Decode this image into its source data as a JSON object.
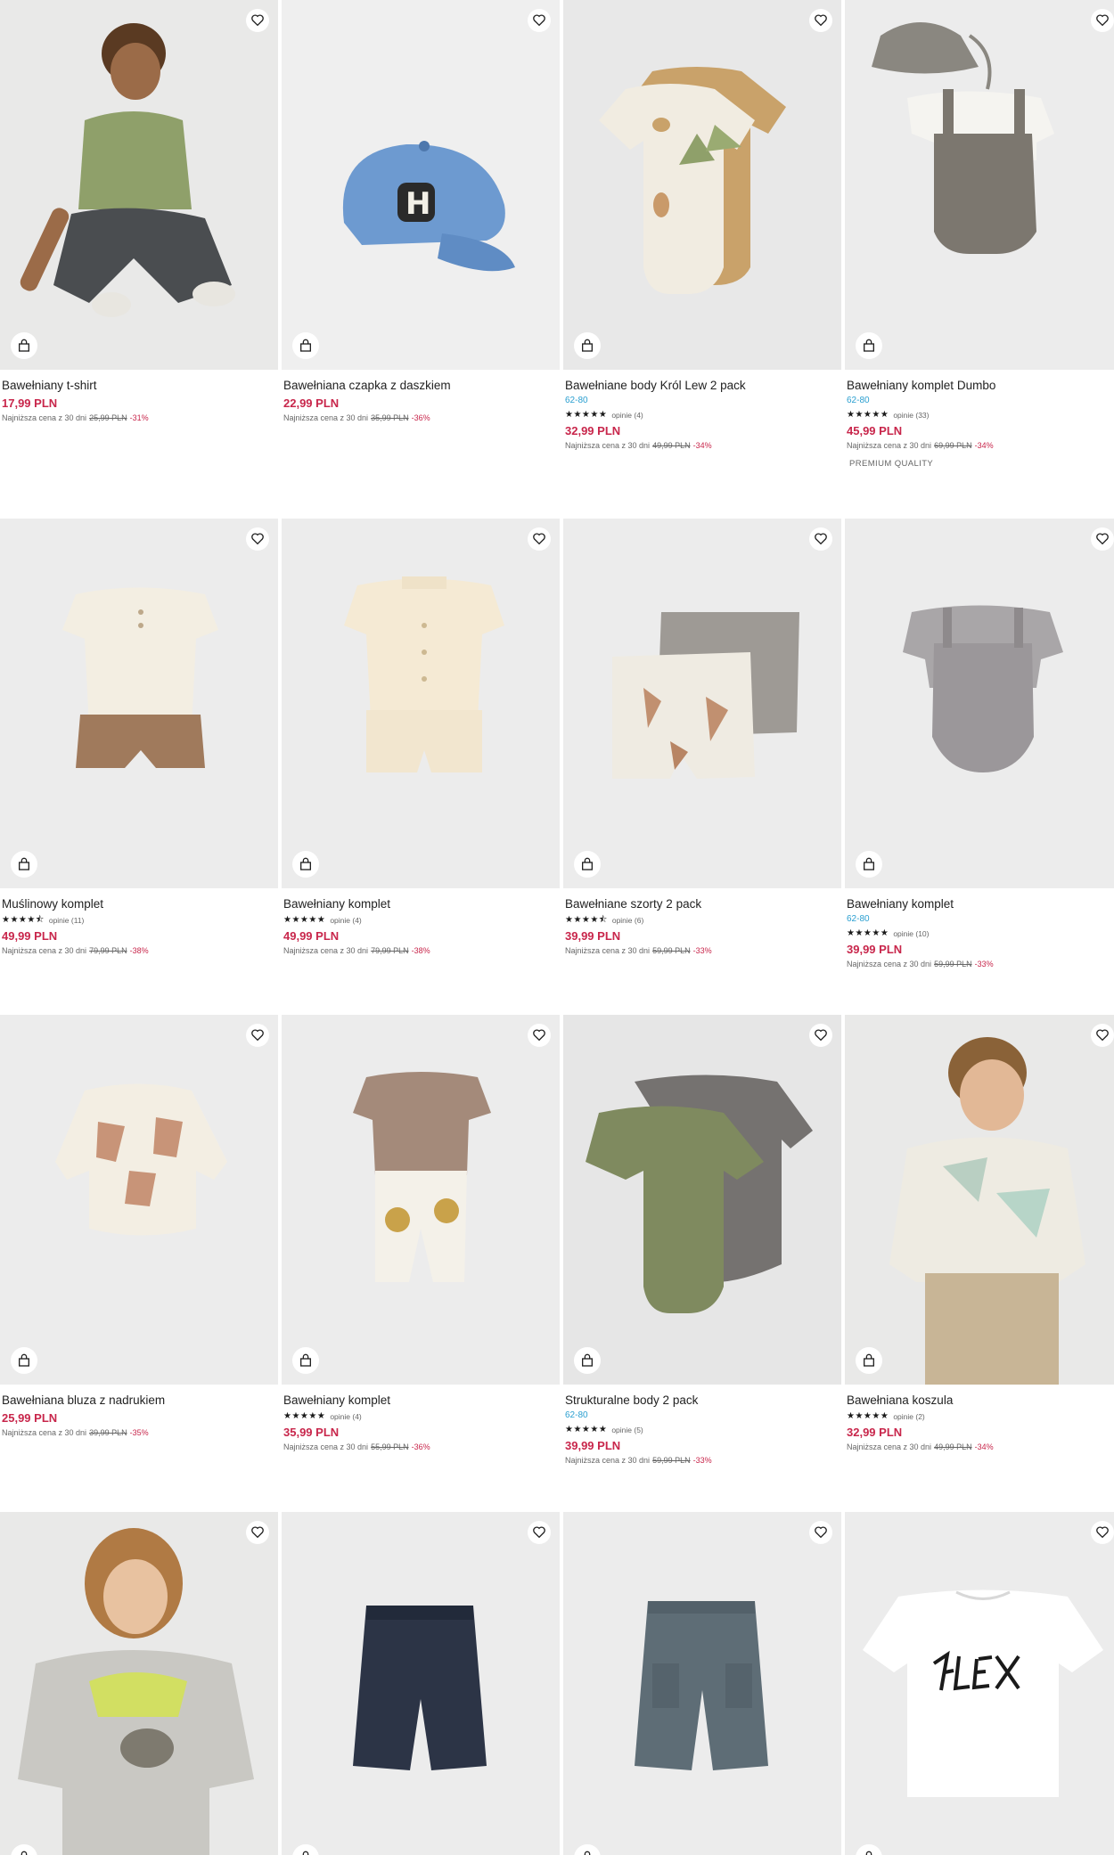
{
  "lowest_label": "Najniższa cena z 30 dni",
  "rows": [
    [
      {
        "name": "Bawełniany t-shirt",
        "sizes": "",
        "stars": "",
        "reviews": "",
        "price": "17,99 PLN",
        "old": "25,99 PLN",
        "disc": "-31%",
        "badge": ""
      },
      {
        "name": "Bawełniana czapka z daszkiem",
        "sizes": "",
        "stars": "",
        "reviews": "",
        "price": "22,99 PLN",
        "old": "35,99 PLN",
        "disc": "-36%",
        "badge": ""
      },
      {
        "name": "Bawełniane body Król Lew 2 pack",
        "sizes": "62-80",
        "stars": "★★★★★",
        "reviews": "opinie (4)",
        "price": "32,99 PLN",
        "old": "49,99 PLN",
        "disc": "-34%",
        "badge": ""
      },
      {
        "name": "Bawełniany komplet Dumbo",
        "sizes": "62-80",
        "stars": "★★★★★",
        "reviews": "opinie (33)",
        "price": "45,99 PLN",
        "old": "69,99 PLN",
        "disc": "-34%",
        "badge": "PREMIUM QUALITY"
      }
    ],
    [
      {
        "name": "Muślinowy komplet",
        "sizes": "",
        "stars": "★★★★⯪",
        "reviews": "opinie (11)",
        "price": "49,99 PLN",
        "old": "79,99 PLN",
        "disc": "-38%",
        "badge": ""
      },
      {
        "name": "Bawełniany komplet",
        "sizes": "",
        "stars": "★★★★★",
        "reviews": "opinie (4)",
        "price": "49,99 PLN",
        "old": "79,99 PLN",
        "disc": "-38%",
        "badge": ""
      },
      {
        "name": "Bawełniane szorty 2 pack",
        "sizes": "",
        "stars": "★★★★⯪",
        "reviews": "opinie (6)",
        "price": "39,99 PLN",
        "old": "59,99 PLN",
        "disc": "-33%",
        "badge": ""
      },
      {
        "name": "Bawełniany komplet",
        "sizes": "62-80",
        "stars": "★★★★★",
        "reviews": "opinie (10)",
        "price": "39,99 PLN",
        "old": "59,99 PLN",
        "disc": "-33%",
        "badge": ""
      }
    ],
    [
      {
        "name": "Bawełniana bluza z nadrukiem",
        "sizes": "",
        "stars": "",
        "reviews": "",
        "price": "25,99 PLN",
        "old": "39,99 PLN",
        "disc": "-35%",
        "badge": ""
      },
      {
        "name": "Bawełniany komplet",
        "sizes": "",
        "stars": "★★★★★",
        "reviews": "opinie (4)",
        "price": "35,99 PLN",
        "old": "55,99 PLN",
        "disc": "-36%",
        "badge": ""
      },
      {
        "name": "Strukturalne body 2 pack",
        "sizes": "62-80",
        "stars": "★★★★★",
        "reviews": "opinie (5)",
        "price": "39,99 PLN",
        "old": "59,99 PLN",
        "disc": "-33%",
        "badge": ""
      },
      {
        "name": "Bawełniana koszula",
        "sizes": "",
        "stars": "★★★★★",
        "reviews": "opinie (2)",
        "price": "32,99 PLN",
        "old": "49,99 PLN",
        "disc": "-34%",
        "badge": ""
      }
    ],
    [
      {
        "name": "",
        "sizes": "",
        "stars": "",
        "reviews": "",
        "price": "",
        "old": "",
        "disc": "",
        "badge": ""
      },
      {
        "name": "",
        "sizes": "",
        "stars": "",
        "reviews": "",
        "price": "",
        "old": "",
        "disc": "",
        "badge": ""
      },
      {
        "name": "",
        "sizes": "",
        "stars": "",
        "reviews": "",
        "price": "",
        "old": "",
        "disc": "",
        "badge": ""
      },
      {
        "name": "",
        "sizes": "",
        "stars": "",
        "reviews": "",
        "price": "",
        "old": "",
        "disc": "",
        "badge": ""
      }
    ]
  ],
  "images": [
    [
      "boy-green-tshirt",
      "blue-cap",
      "lion-king-bodies",
      "dumbo-set-with-hat"
    ],
    [
      "muslin-set",
      "cream-shirt-set",
      "shorts-2-pack",
      "grey-romper-set"
    ],
    [
      "zebra-sweatshirt",
      "lion-pants-set",
      "olive-bodies-2-pack",
      "boy-print-shirt"
    ],
    [
      "boy-tiedye-tshirt",
      "navy-shorts",
      "grey-blue-shorts",
      "white-flex-tshirt"
    ]
  ],
  "icons": {
    "favorite": "heart-icon",
    "bag": "shopping-bag-icon"
  }
}
